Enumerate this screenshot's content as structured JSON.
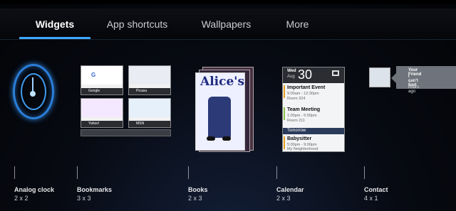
{
  "tabs": [
    {
      "label": "Widgets",
      "active": true
    },
    {
      "label": "App shortcuts",
      "active": false
    },
    {
      "label": "Wallpapers",
      "active": false
    },
    {
      "label": "More",
      "active": false
    }
  ],
  "colors": {
    "accent": "#3ea8ff",
    "background": "#05060a"
  },
  "widgets": [
    {
      "name": "Analog clock",
      "size": "2 x 2",
      "icon": "analog-clock-icon"
    },
    {
      "name": "Bookmarks",
      "size": "3 x 3",
      "icon": "bookmarks-icon",
      "thumbs": [
        "Google",
        "Picasa",
        "Yahoo!",
        "MSN"
      ]
    },
    {
      "name": "Books",
      "size": "2 x 3",
      "icon": "books-icon",
      "cover_title": "Alice's"
    },
    {
      "name": "Calendar",
      "size": "2 x 3",
      "icon": "calendar-icon",
      "day": "Wed",
      "month": "Aug",
      "date": "30",
      "events": [
        {
          "title": "Important Event",
          "time": "9:00am - 12:30pm",
          "place": "Room 324"
        },
        {
          "title": "Team Meeting",
          "time": "1:00pm - 5:00pm",
          "place": "Room 211"
        },
        {
          "title": "Babysitter",
          "time": "5:00pm - 9:00pm",
          "place": "My Neighborhood"
        }
      ],
      "tomorrow_label": "Tomorrow"
    },
    {
      "name": "Contact",
      "size": "4 x 1",
      "icon": "contact-icon",
      "contact_name": "Your Friend",
      "message": "I can't wait",
      "time": "2 hours ago"
    }
  ]
}
